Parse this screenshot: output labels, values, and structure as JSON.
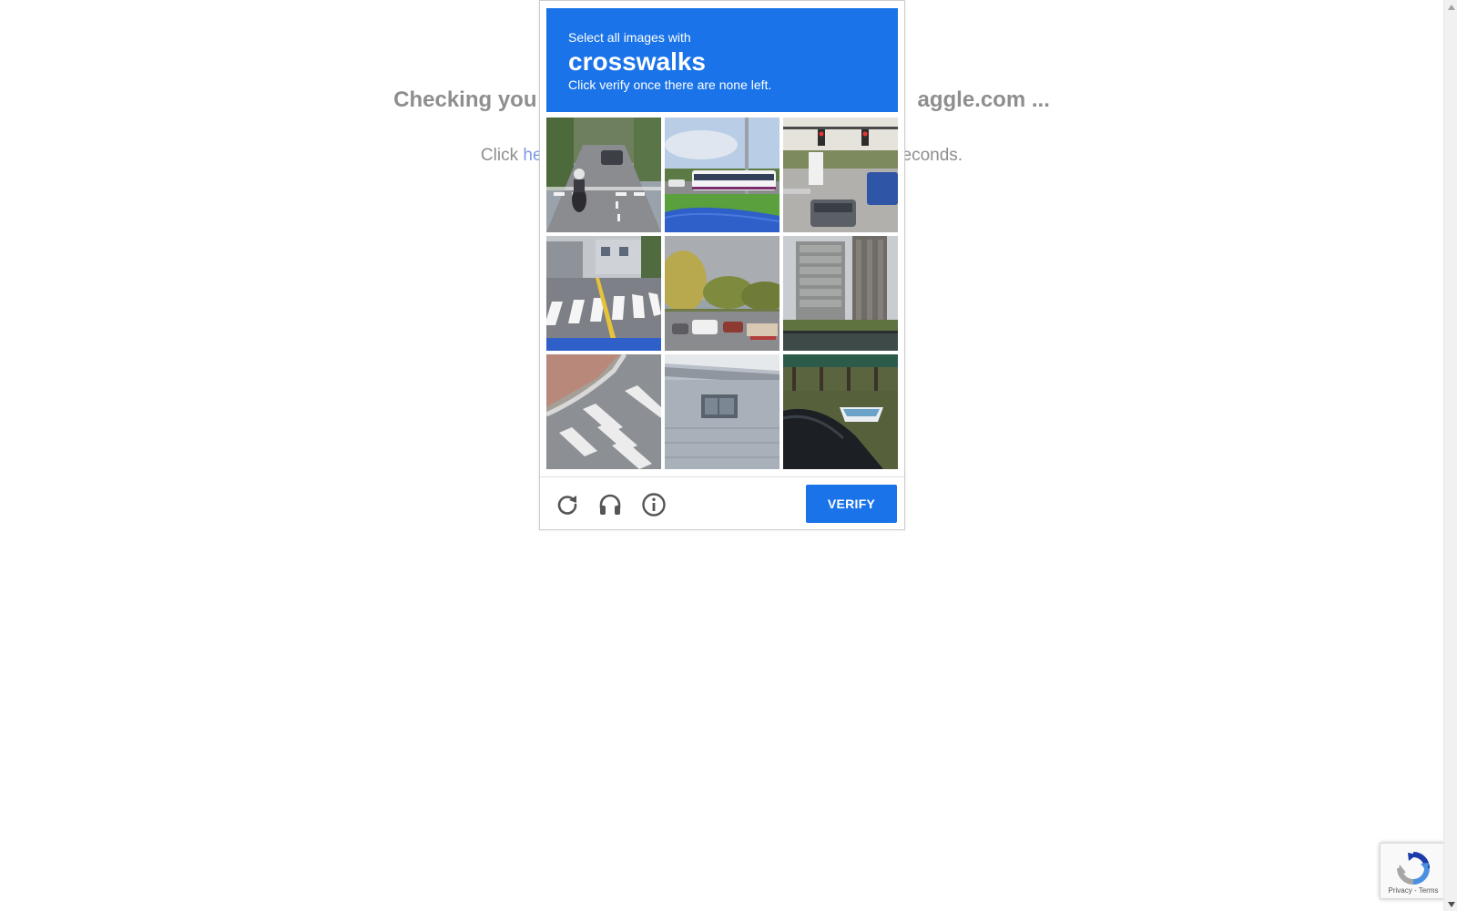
{
  "background": {
    "title_prefix": "Checking you",
    "title_suffix": "aggle.com ...",
    "redirect_prefix": "Click ",
    "redirect_link": "he",
    "redirect_suffix": "econds."
  },
  "captcha": {
    "instruction_pre": "Select all images with",
    "instruction_target": "crosswalks",
    "instruction_post": "Click verify once there are none left.",
    "tiles": [
      {
        "content": "motorcycle on road with crosswalk"
      },
      {
        "content": "bus on road by grass"
      },
      {
        "content": "cars at intersection with traffic lights"
      },
      {
        "content": "zebra crosswalk on street"
      },
      {
        "content": "parking lot with trees"
      },
      {
        "content": "tall buildings by water"
      },
      {
        "content": "crosswalk at curb"
      },
      {
        "content": "building facade"
      },
      {
        "content": "boat near pier"
      }
    ],
    "reload_icon": "reload-icon",
    "audio_icon": "headphones-icon",
    "info_icon": "info-icon",
    "verify_label": "VERIFY",
    "accent_color": "#1a73e8"
  },
  "badge": {
    "privacy": "Privacy",
    "separator": " - ",
    "terms": "Terms"
  }
}
